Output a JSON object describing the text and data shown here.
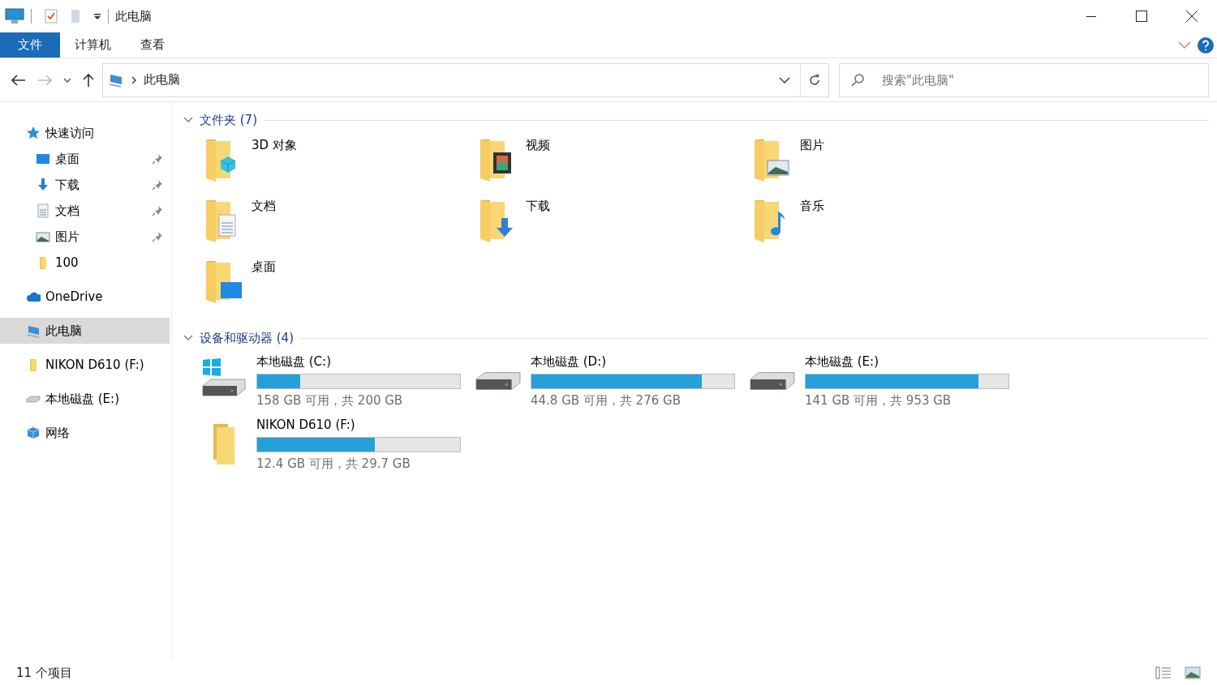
{
  "window": {
    "title": "此电脑"
  },
  "ribbon_tabs": [
    {
      "label": "文件",
      "selected": true
    },
    {
      "label": "计算机",
      "selected": false
    },
    {
      "label": "查看",
      "selected": false
    }
  ],
  "address": {
    "path": "此电脑"
  },
  "search": {
    "placeholder": "搜索\"此电脑\""
  },
  "sidebar": {
    "items": [
      {
        "label": "快速访问",
        "kind": "star",
        "selected": false,
        "children": [
          {
            "label": "桌面",
            "kind": "desktop",
            "pinned": true,
            "selected": false
          },
          {
            "label": "下载",
            "kind": "download",
            "pinned": true,
            "selected": false
          },
          {
            "label": "文档",
            "kind": "document",
            "pinned": true,
            "selected": false
          },
          {
            "label": "图片",
            "kind": "picture",
            "pinned": true,
            "selected": false
          },
          {
            "label": "100",
            "kind": "folder",
            "pinned": false,
            "selected": false
          }
        ]
      },
      {
        "label": "OneDrive",
        "kind": "cloud",
        "selected": false
      },
      {
        "label": "此电脑",
        "kind": "pc",
        "selected": true
      },
      {
        "label": "NIKON D610 (F:)",
        "kind": "folder",
        "selected": false
      },
      {
        "label": "本地磁盘 (E:)",
        "kind": "drive",
        "selected": false
      },
      {
        "label": "网络",
        "kind": "network",
        "selected": false
      }
    ]
  },
  "sections": [
    {
      "title": "文件夹 (7)",
      "expanded": true,
      "kind": "folders",
      "items": [
        {
          "name": "3D 对象",
          "kind": "cube"
        },
        {
          "name": "视频",
          "kind": "video"
        },
        {
          "name": "图片",
          "kind": "picture"
        },
        {
          "name": "文档",
          "kind": "document"
        },
        {
          "name": "下载",
          "kind": "download"
        },
        {
          "name": "音乐",
          "kind": "music"
        },
        {
          "name": "桌面",
          "kind": "desktop"
        }
      ]
    },
    {
      "title": "设备和驱动器 (4)",
      "expanded": true,
      "kind": "drives",
      "items": [
        {
          "name": "本地磁盘 (C:)",
          "kind": "system",
          "level": 0.21,
          "space": "158 GB 可用，共 200 GB"
        },
        {
          "name": "本地磁盘 (D:)",
          "kind": "hdd",
          "level": 0.84,
          "space": "44.8 GB 可用，共 276 GB"
        },
        {
          "name": "本地磁盘 (E:)",
          "kind": "hdd",
          "level": 0.85,
          "space": "141 GB 可用，共 953 GB"
        },
        {
          "name": "NIKON D610 (F:)",
          "kind": "removable",
          "level": 0.58,
          "space": "12.4 GB 可用，共 29.7 GB"
        }
      ]
    }
  ],
  "status_bar": {
    "count": "11 个项目"
  }
}
